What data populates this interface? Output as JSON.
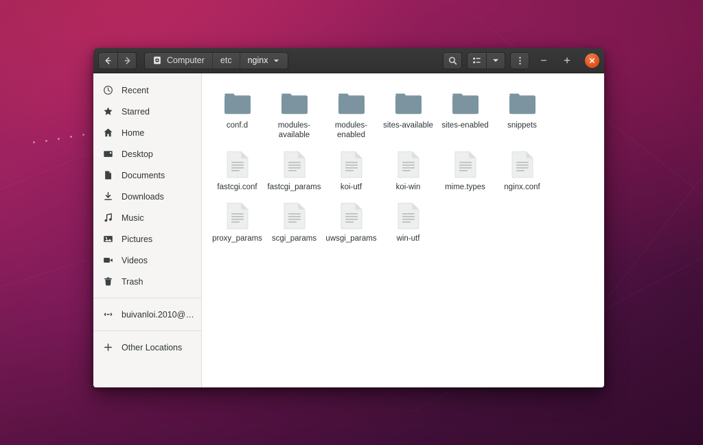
{
  "window": {
    "title": "nginx",
    "nav": {
      "back_label": "Back",
      "back_icon": "arrow-left-icon",
      "forward_label": "Forward",
      "forward_icon": "arrow-right-icon"
    },
    "pathbar": {
      "segments": [
        {
          "label": "Computer",
          "icon": "computer-icon"
        },
        {
          "label": "etc",
          "icon": ""
        },
        {
          "label": "nginx",
          "icon": "chevron-down-icon",
          "current": true
        }
      ]
    },
    "toolbar": {
      "search_label": "Search",
      "search_icon": "search-icon",
      "view_label": "View options",
      "view_icon": "list-view-icon",
      "view_dropdown_icon": "chevron-down-icon",
      "menu_label": "Menu",
      "menu_icon": "kebab-menu-icon"
    },
    "controls": {
      "minimize_label": "–",
      "minimize_icon": "minimize-icon",
      "maximize_label": "+",
      "maximize_icon": "maximize-icon",
      "close_label": "✕",
      "close_icon": "close-icon"
    },
    "accent_color": "#e4571f",
    "headerbar_color": "#353535",
    "sidebar_color": "#f6f5f4",
    "content_color": "#ffffff",
    "folder_color": "#7b94a0",
    "file_color": "#eceded"
  },
  "sidebar": {
    "items": [
      {
        "label": "Recent",
        "icon": "clock-icon"
      },
      {
        "label": "Starred",
        "icon": "star-icon"
      },
      {
        "label": "Home",
        "icon": "home-icon"
      },
      {
        "label": "Desktop",
        "icon": "desktop-icon"
      },
      {
        "label": "Documents",
        "icon": "document-icon"
      },
      {
        "label": "Downloads",
        "icon": "download-icon"
      },
      {
        "label": "Music",
        "icon": "music-note-icon"
      },
      {
        "label": "Pictures",
        "icon": "picture-icon"
      },
      {
        "label": "Videos",
        "icon": "video-camera-icon"
      },
      {
        "label": "Trash",
        "icon": "trash-icon"
      }
    ],
    "accounts": [
      {
        "label": "buivanloi.2010@g…",
        "icon": "network-connect-icon"
      }
    ],
    "footer": [
      {
        "label": "Other Locations",
        "icon": "plus-icon"
      }
    ]
  },
  "files": {
    "items": [
      {
        "name": "conf.d",
        "type": "folder"
      },
      {
        "name": "modules-available",
        "type": "folder"
      },
      {
        "name": "modules-enabled",
        "type": "folder"
      },
      {
        "name": "sites-available",
        "type": "folder"
      },
      {
        "name": "sites-enabled",
        "type": "folder"
      },
      {
        "name": "snippets",
        "type": "folder"
      },
      {
        "name": "fastcgi.conf",
        "type": "file"
      },
      {
        "name": "fastcgi_params",
        "type": "file"
      },
      {
        "name": "koi-utf",
        "type": "file"
      },
      {
        "name": "koi-win",
        "type": "file"
      },
      {
        "name": "mime.types",
        "type": "file"
      },
      {
        "name": "nginx.conf",
        "type": "file"
      },
      {
        "name": "proxy_params",
        "type": "file"
      },
      {
        "name": "scgi_params",
        "type": "file"
      },
      {
        "name": "uwsgi_params",
        "type": "file"
      },
      {
        "name": "win-utf",
        "type": "file"
      }
    ]
  }
}
